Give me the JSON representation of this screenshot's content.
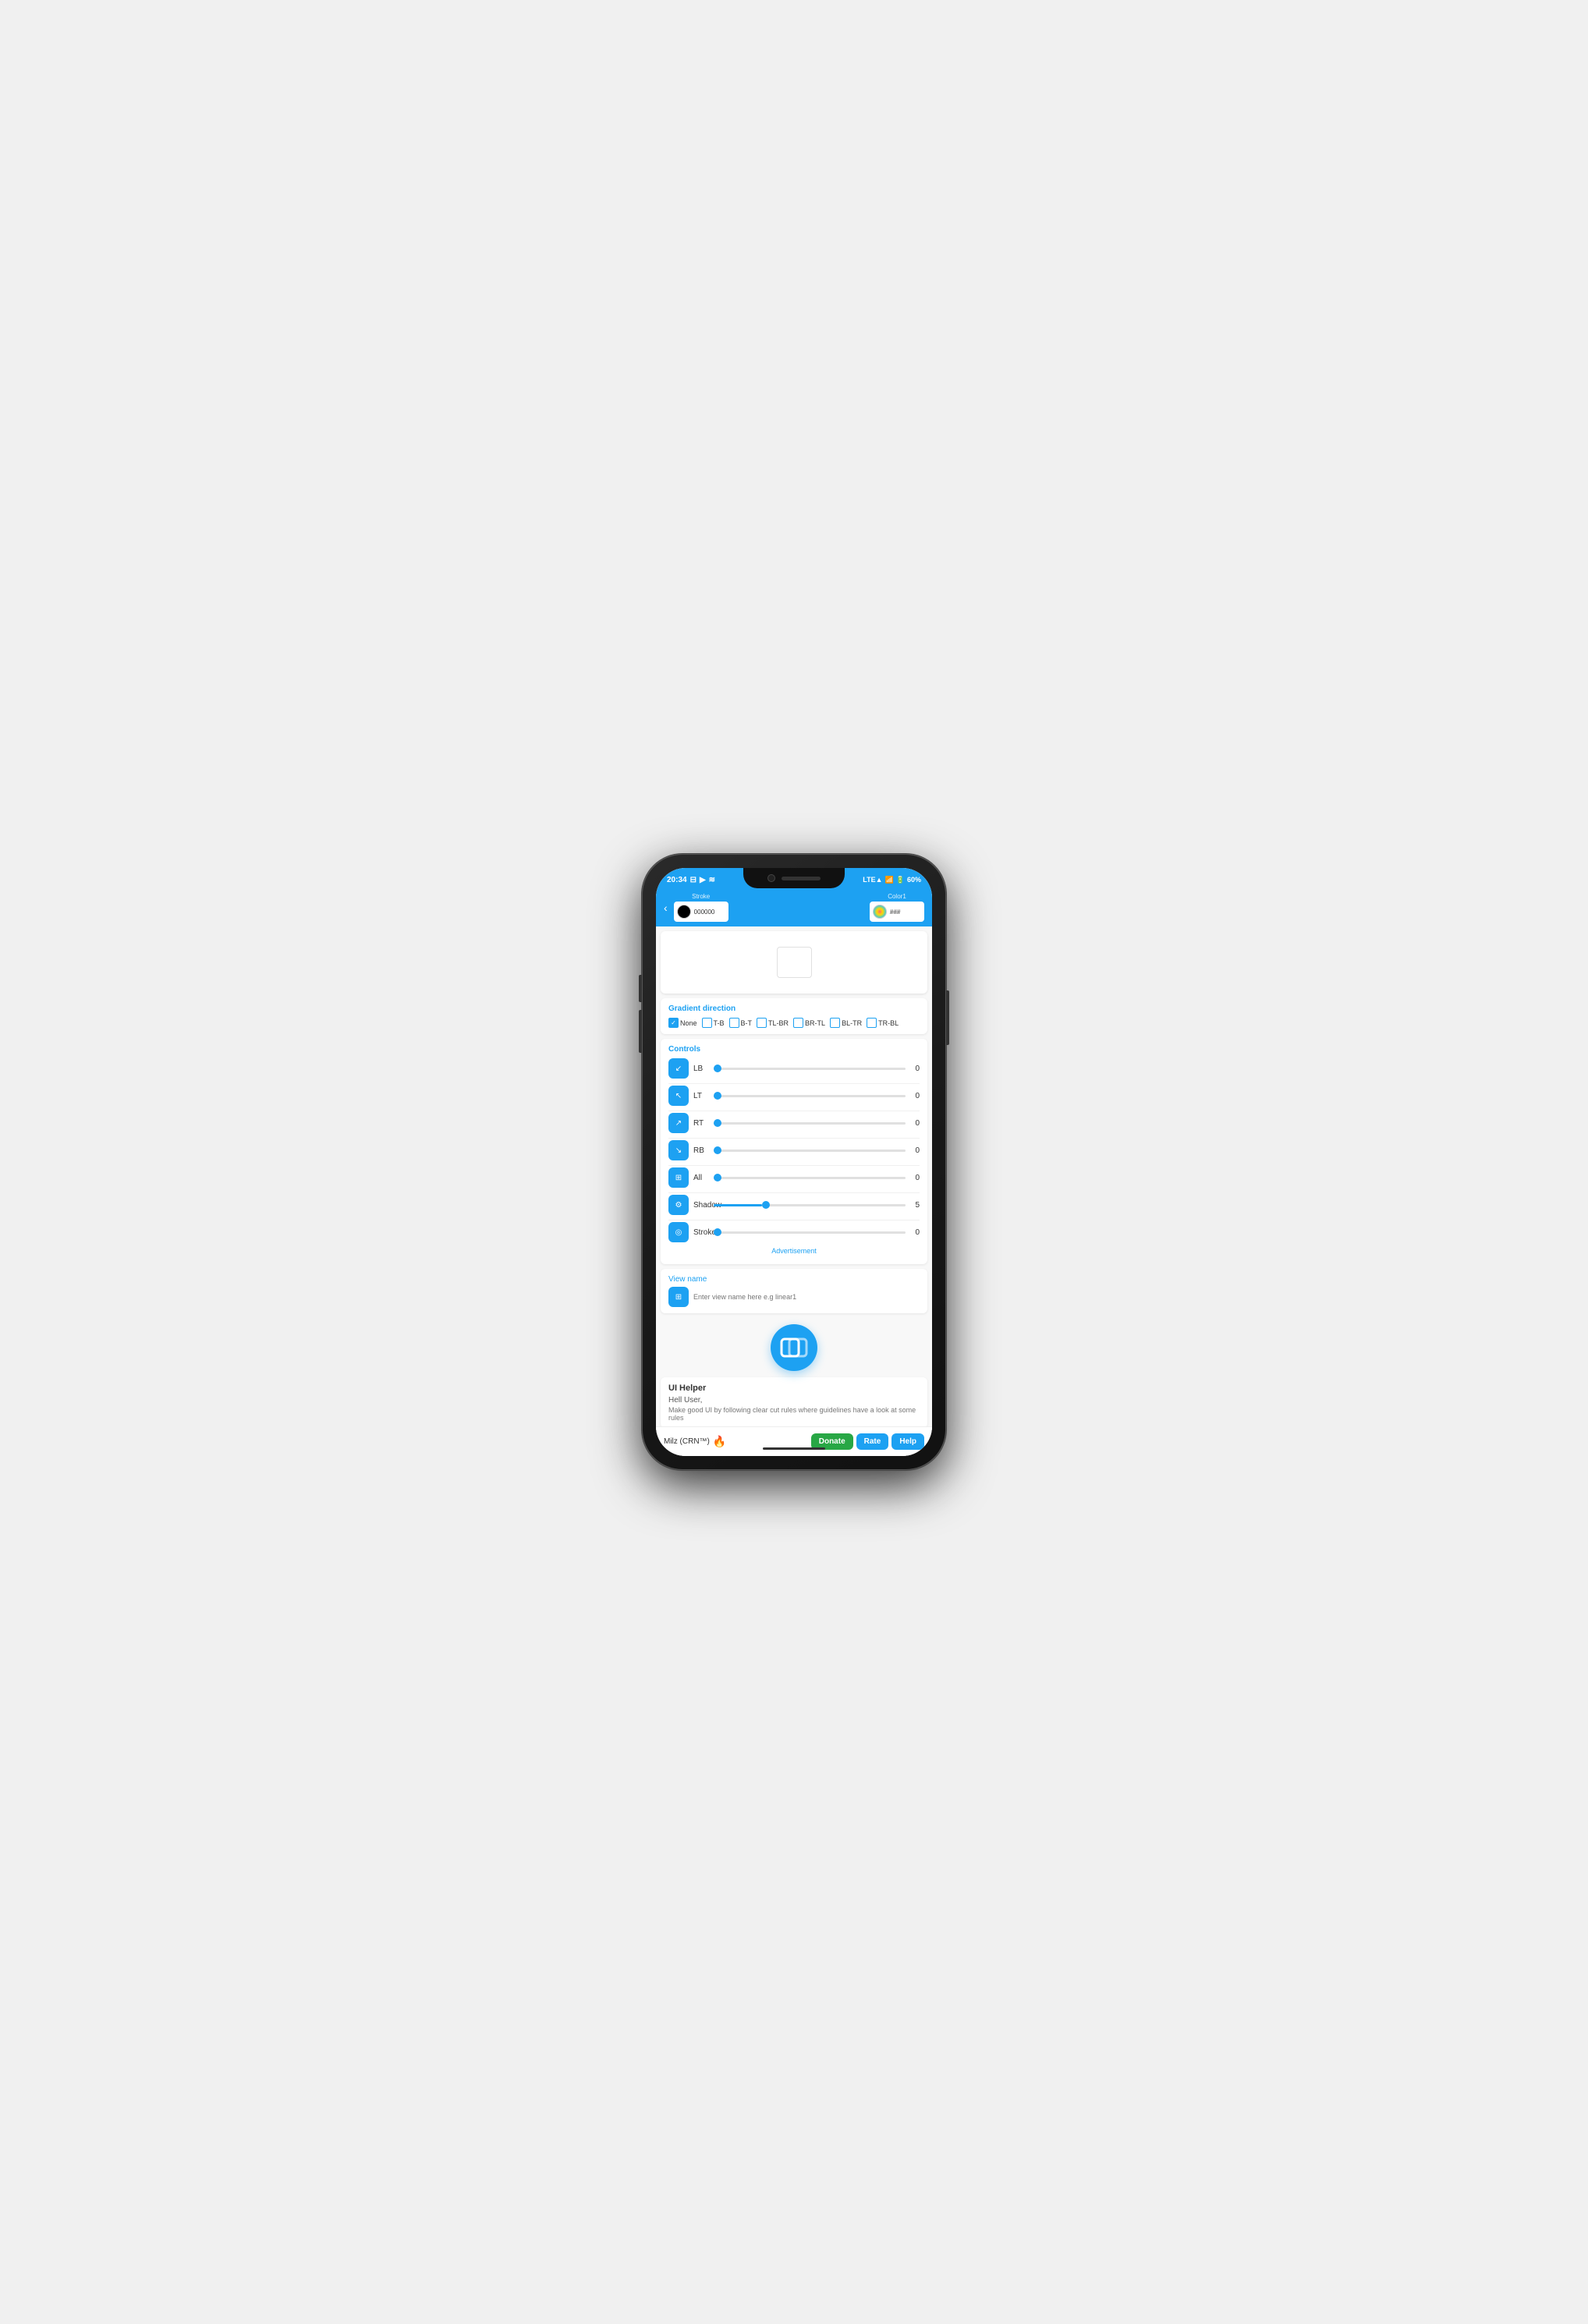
{
  "phone": {
    "status_bar": {
      "time": "20:34",
      "network": "LTE",
      "battery": "60%",
      "icons": [
        "message-icon",
        "play-icon",
        "notification-icon"
      ]
    },
    "header": {
      "stroke_label": "Stroke",
      "stroke_color_value": "000000",
      "color1_label": "Color1",
      "color1_value": "###"
    },
    "gradient": {
      "section_title": "Gradient direction",
      "options": [
        {
          "label": "None",
          "checked": true
        },
        {
          "label": "T-B",
          "checked": false
        },
        {
          "label": "B-T",
          "checked": false
        },
        {
          "label": "TL-BR",
          "checked": false
        },
        {
          "label": "BR-TL",
          "checked": false
        },
        {
          "label": "BL-TR",
          "checked": false
        },
        {
          "label": "TR-BL",
          "checked": false
        }
      ]
    },
    "controls": {
      "section_title": "Controls",
      "items": [
        {
          "id": "lb",
          "label": "LB",
          "icon": "↙",
          "value": "0",
          "fill_percent": 0
        },
        {
          "id": "lt",
          "label": "LT",
          "icon": "↖",
          "value": "0",
          "fill_percent": 0
        },
        {
          "id": "rt",
          "label": "RT",
          "icon": "↗",
          "value": "0",
          "fill_percent": 0
        },
        {
          "id": "rb",
          "label": "RB",
          "icon": "↘",
          "value": "0",
          "fill_percent": 0
        },
        {
          "id": "all",
          "label": "All",
          "icon": "⊞",
          "value": "0",
          "fill_percent": 0
        }
      ],
      "shadow": {
        "label": "Shadow",
        "icon": "⚙",
        "value": "5",
        "fill_percent": 25
      },
      "stroke": {
        "label": "Stroke",
        "icon": "◎",
        "value": "0",
        "fill_percent": 0
      }
    },
    "advertisement_label": "Advertisement",
    "view_name": {
      "label": "View name",
      "placeholder": "Enter view name here e.g linear1",
      "icon": "⊞"
    },
    "app_logo_alt": "UI Helper App Logo",
    "helper": {
      "title": "UI Helper",
      "greeting": "Hell User,",
      "text": "Make good UI by following clear cut rules where guidelines have a look at some rules"
    },
    "bottom_bar": {
      "brand": "Milz (CRN™)",
      "fire": "🔥",
      "donate_label": "Donate",
      "rate_label": "Rate",
      "help_label": "Help"
    }
  }
}
